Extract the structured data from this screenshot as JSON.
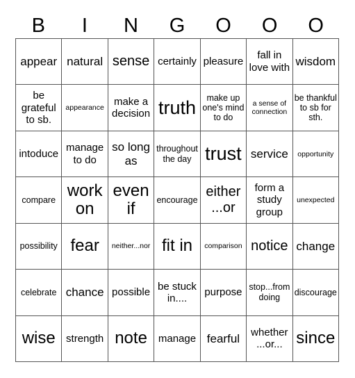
{
  "header": {
    "letters": [
      "B",
      "I",
      "N",
      "G",
      "O",
      "O",
      "O"
    ]
  },
  "cells": [
    [
      "appear",
      "natural",
      "sense",
      "certainly",
      "pleasure",
      "fall in love with",
      "wisdom"
    ],
    [
      "be grateful to sb.",
      "appearance",
      "make a decision",
      "truth",
      "make up one's mind to do",
      "a sense of connection",
      "be thankful to sb for sth."
    ],
    [
      "intoduce",
      "manage to do",
      "so long as",
      "throughout the day",
      "trust",
      "service",
      "opportunity"
    ],
    [
      "compare",
      "work on",
      "even if",
      "encourage",
      "either ...or",
      "form a study group",
      "unexpected"
    ],
    [
      "possibility",
      "fear",
      "neither...nor",
      "fit in",
      "comparison",
      "notice",
      "change"
    ],
    [
      "celebrate",
      "chance",
      "possible",
      "be stuck in....",
      "purpose",
      "stop...from doing",
      "discourage"
    ],
    [
      "wise",
      "strength",
      "note",
      "manage",
      "fearful",
      "whether ...or...",
      "since"
    ]
  ]
}
